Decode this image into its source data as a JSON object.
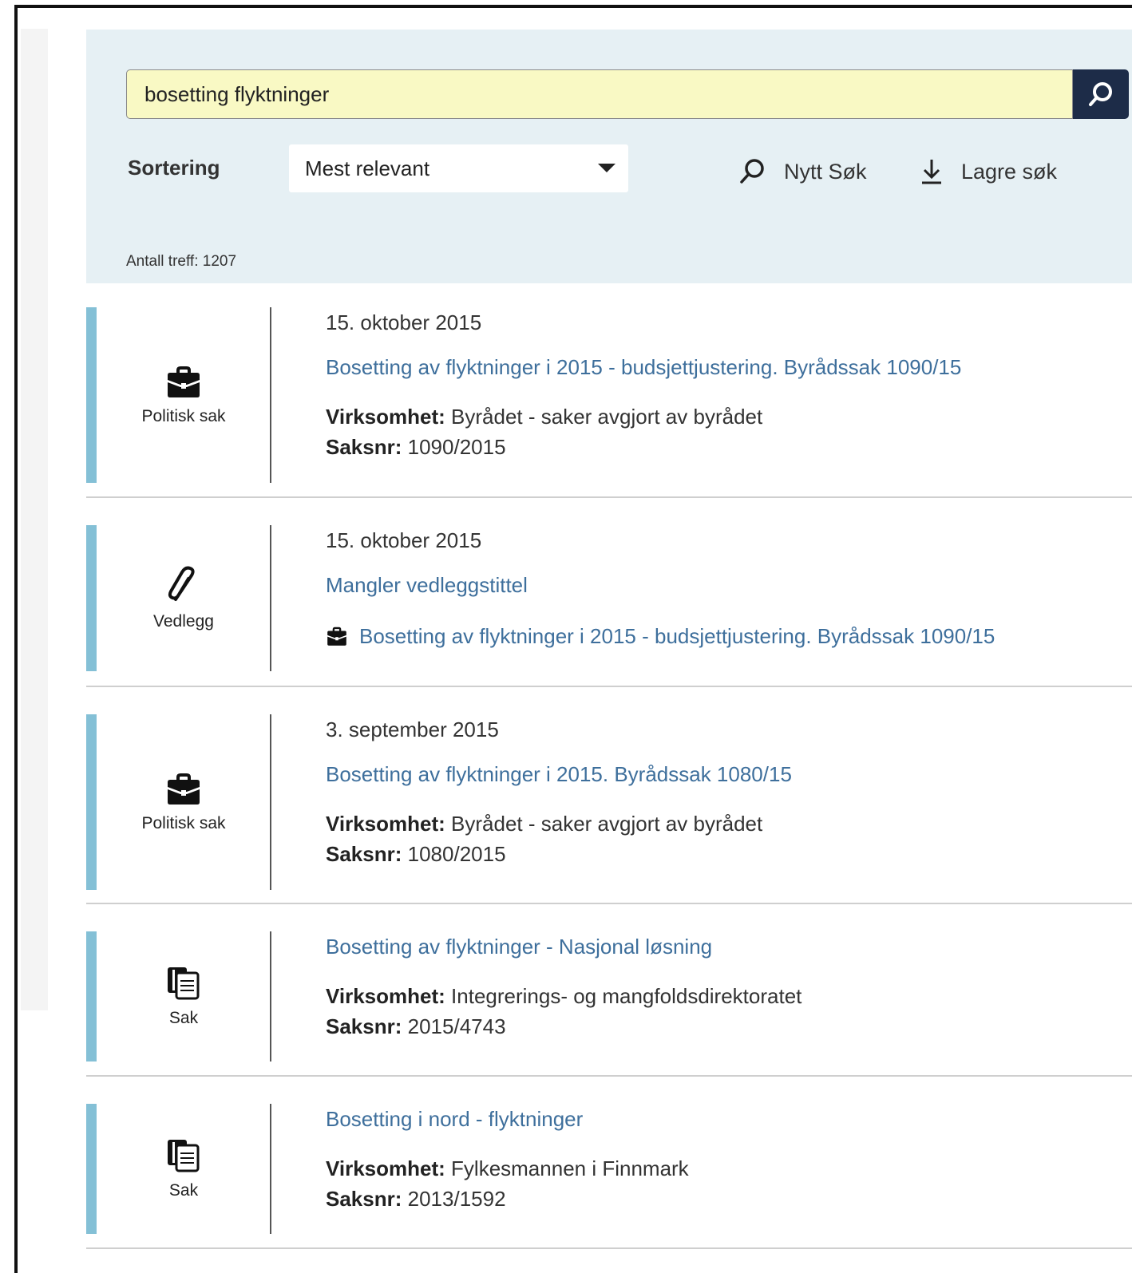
{
  "search": {
    "query": "bosetting flyktninger",
    "sort_label": "Sortering",
    "sort_value": "Mest relevant",
    "new_search": "Nytt Søk",
    "save_search": "Lagre søk",
    "count": "Antall treff: 1207"
  },
  "labels": {
    "virksomhet": "Virksomhet:",
    "saksnr": "Saksnr:"
  },
  "colors": {
    "accent_bar": "#84c0d6",
    "link": "#3e6f9c",
    "search_button": "#1d2c48",
    "search_field": "#f9f9c4",
    "panel": "#e6f0f4"
  },
  "results": [
    {
      "type": "Politisk sak",
      "icon": "briefcase-icon",
      "date": "15. oktober 2015",
      "title": "Bosetting av flyktninger i 2015 - budsjettjustering. Byrådssak 1090/15",
      "virksomhet": "Byrådet - saker avgjort av byrådet",
      "saksnr": "1090/2015"
    },
    {
      "type": "Vedlegg",
      "icon": "paperclip-icon",
      "date": "15. oktober 2015",
      "title": "Mangler vedleggstittel",
      "parent": "Bosetting av flyktninger i 2015 - budsjettjustering. Byrådssak 1090/15"
    },
    {
      "type": "Politisk sak",
      "icon": "briefcase-icon",
      "date": "3. september 2015",
      "title": "Bosetting av flyktninger i 2015. Byrådssak 1080/15",
      "virksomhet": "Byrådet - saker avgjort av byrådet",
      "saksnr": "1080/2015"
    },
    {
      "type": "Sak",
      "icon": "documents-icon",
      "title": "Bosetting av flyktninger - Nasjonal løsning",
      "virksomhet": "Integrerings- og mangfoldsdirektoratet",
      "saksnr": "2015/4743"
    },
    {
      "type": "Sak",
      "icon": "documents-icon",
      "title": "Bosetting i nord - flyktninger",
      "virksomhet": "Fylkesmannen i Finnmark",
      "saksnr": "2013/1592"
    }
  ]
}
